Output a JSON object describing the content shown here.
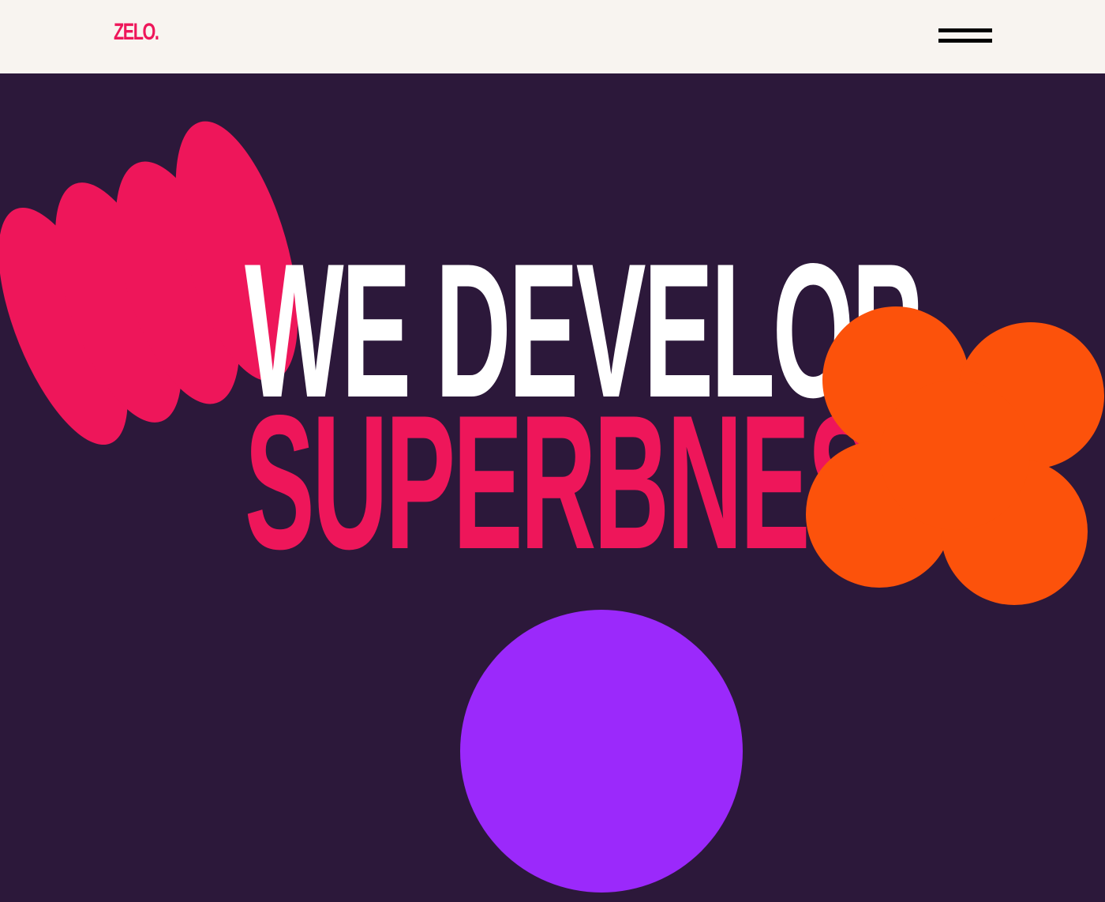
{
  "header": {
    "logo": "ZELO.",
    "menu_icon": "hamburger-menu-icon"
  },
  "hero": {
    "headline_line1": "WE DEVELOP",
    "headline_line2": "SUPERBNESS"
  },
  "colors": {
    "background": "#2c183a",
    "header_bg": "#f8f4f0",
    "brand_pink": "#ee165a",
    "orange": "#fc520b",
    "purple": "#9b29fb",
    "white": "#ffffff"
  },
  "decorations": [
    "pink-wave-shape",
    "orange-flower-shape",
    "purple-circle-shape"
  ]
}
